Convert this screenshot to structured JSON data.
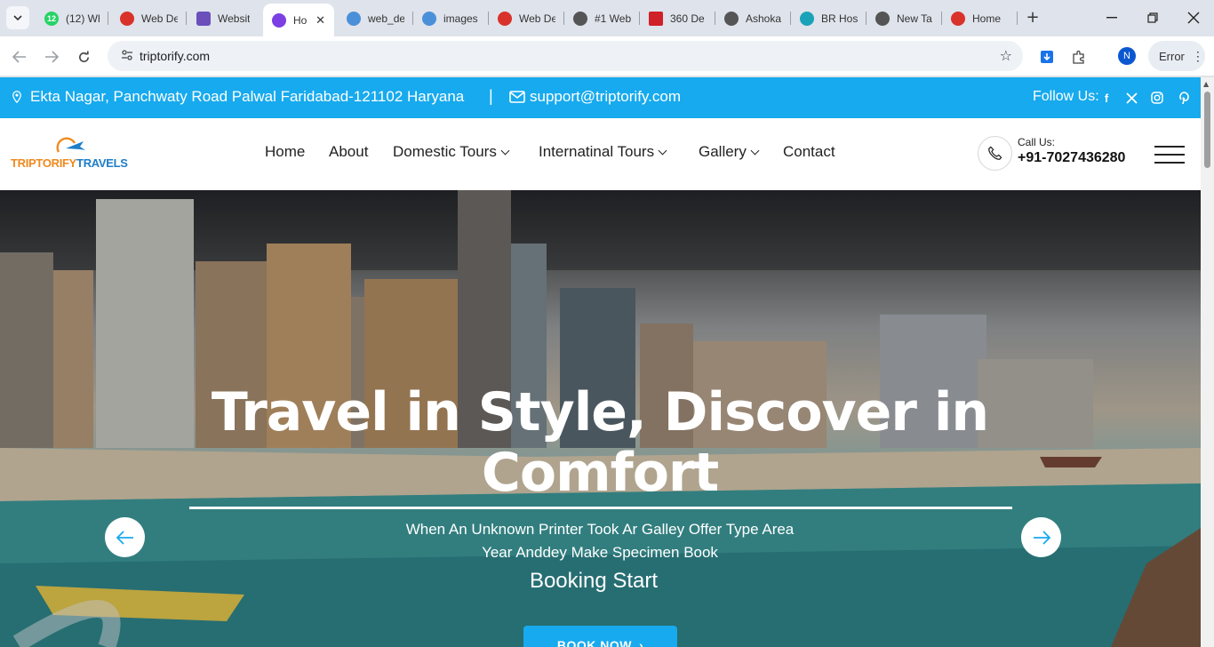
{
  "browser": {
    "tabs": [
      {
        "label": "(12) Wh",
        "favicon_color": "#25d366",
        "favicon_text": "12",
        "active": false
      },
      {
        "label": "Web De",
        "favicon_color": "#d9322b",
        "favicon_text": "",
        "active": false
      },
      {
        "label": "Websit",
        "favicon_color": "#6b4fbb",
        "favicon_text": "",
        "active": false
      },
      {
        "label": "Ho",
        "favicon_color": "#7b3fe4",
        "favicon_text": "",
        "active": true
      },
      {
        "label": "web_de",
        "favicon_color": "#4a90d9",
        "favicon_text": "",
        "active": false
      },
      {
        "label": "images",
        "favicon_color": "#4a90d9",
        "favicon_text": "",
        "active": false
      },
      {
        "label": "Web De",
        "favicon_color": "#d9322b",
        "favicon_text": "",
        "active": false
      },
      {
        "label": "#1 Web",
        "favicon_color": "#555555",
        "favicon_text": "",
        "active": false
      },
      {
        "label": "360 De",
        "favicon_color": "#d0202a",
        "favicon_text": "",
        "active": false
      },
      {
        "label": "Ashoka",
        "favicon_color": "#555555",
        "favicon_text": "",
        "active": false
      },
      {
        "label": "BR Hos",
        "favicon_color": "#1aa3b8",
        "favicon_text": "",
        "active": false
      },
      {
        "label": "New Ta",
        "favicon_color": "#555555",
        "favicon_text": "",
        "active": false
      },
      {
        "label": "Home",
        "favicon_color": "#d9322b",
        "favicon_text": "",
        "active": false
      }
    ],
    "url": "triptorify.com",
    "profile_initial": "N",
    "error_label": "Error"
  },
  "topbar": {
    "address": "Ekta Nagar, Panchwaty Road Palwal Faridabad-121102 Haryana",
    "divider": "|",
    "email": "support@triptorify.com",
    "follow_label": "Follow Us:",
    "socials": [
      "facebook-icon",
      "x-icon",
      "instagram-icon",
      "pinterest-icon"
    ]
  },
  "header": {
    "logo_part1": "TRIPTORIFY",
    "logo_part2": "TRAVELS",
    "nav": [
      {
        "label": "Home",
        "dropdown": false
      },
      {
        "label": "About",
        "dropdown": false
      },
      {
        "label": "Domestic Tours",
        "dropdown": true
      },
      {
        "label": "Internatinal Tours",
        "dropdown": true
      },
      {
        "label": "Gallery",
        "dropdown": true
      },
      {
        "label": "Contact",
        "dropdown": false
      }
    ],
    "call_label": "Call Us:",
    "call_number": "+91-7027436280"
  },
  "hero": {
    "title": "Travel in Style, Discover in Comfort",
    "subtitle_line1": "When An Unknown Printer Took Ar Galley Offer Type Area",
    "subtitle_line2": "Year Anddey Make Specimen Book",
    "booking": "Booking Start",
    "button": "BOOK NOW"
  },
  "colors": {
    "accent": "#17aaee",
    "logo_orange": "#ef8a1f",
    "logo_blue": "#1e7ec8"
  }
}
